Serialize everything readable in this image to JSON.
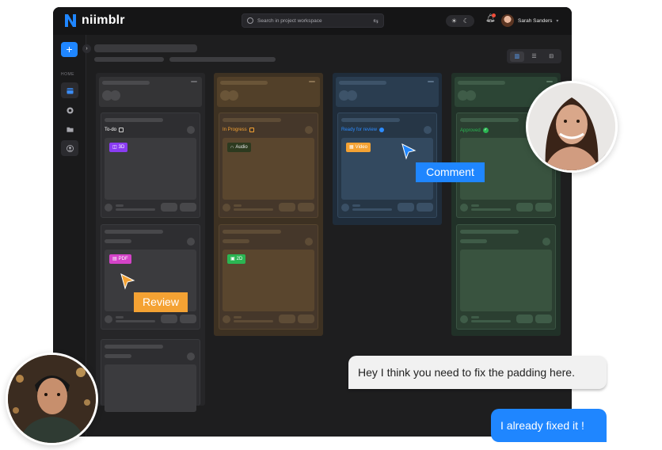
{
  "app": {
    "name": "niimblr",
    "brand_color": "#1f86ff",
    "search_placeholder": "Search in project workspace",
    "user_name": "Sarah Sanders",
    "sidebar_home_label": "HOME",
    "add_label": "+",
    "collapse_label": "›"
  },
  "columns": [
    {
      "status": "To-do",
      "status_icon": "checkbox-icon",
      "accent": "#ffffff",
      "cards": [
        {
          "tag": "3D",
          "tag_color": "#8a3cf2",
          "tag_icon": "cube-icon"
        },
        {
          "tag": "PDF",
          "tag_color": "#d443c8",
          "tag_icon": "document-icon"
        },
        {
          "tag": ""
        }
      ]
    },
    {
      "status": "In Progress",
      "status_icon": "checkbox-icon",
      "accent": "#f4a233",
      "cards": [
        {
          "tag": "Audio",
          "tag_color": "#2d3a1f",
          "tag_icon": "headphones-icon"
        },
        {
          "tag": "2D",
          "tag_color": "#2bb552",
          "tag_icon": "image-icon"
        }
      ]
    },
    {
      "status": "Ready for review",
      "status_icon": "dot-icon",
      "accent": "#2d8cff",
      "cards": [
        {
          "tag": "Video",
          "tag_color": "#f4a233",
          "tag_icon": "film-icon"
        }
      ]
    },
    {
      "status": "Approved",
      "status_icon": "check-circle-icon",
      "accent": "#2bb552",
      "cards": [
        {
          "tag": ""
        },
        {
          "tag": ""
        }
      ]
    }
  ],
  "overlays": {
    "comment_label": "Comment",
    "comment_color": "#1f86ff",
    "review_label": "Review",
    "review_color": "#f4a233"
  },
  "chat": {
    "message_1": "Hey I think you need to fix the padding here.",
    "message_2": "I already fixed it !"
  }
}
